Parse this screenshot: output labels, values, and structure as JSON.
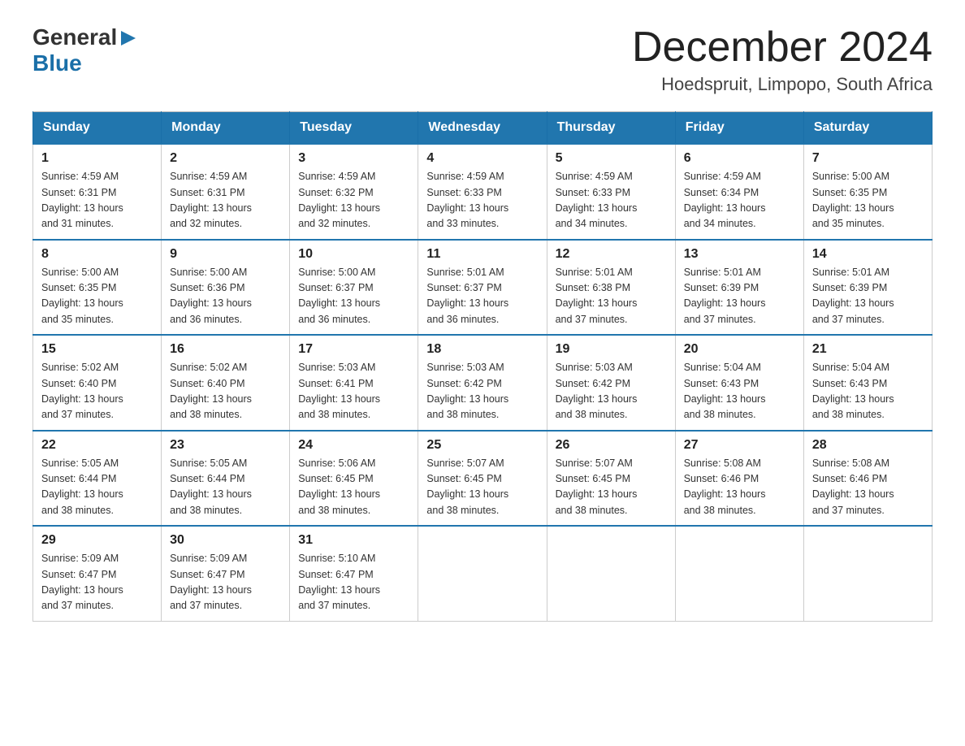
{
  "logo": {
    "general": "General",
    "arrow": "▶",
    "blue": "Blue"
  },
  "title": "December 2024",
  "subtitle": "Hoedspruit, Limpopo, South Africa",
  "weekdays": [
    "Sunday",
    "Monday",
    "Tuesday",
    "Wednesday",
    "Thursday",
    "Friday",
    "Saturday"
  ],
  "weeks": [
    [
      {
        "day": "1",
        "sunrise": "4:59 AM",
        "sunset": "6:31 PM",
        "daylight": "13 hours and 31 minutes."
      },
      {
        "day": "2",
        "sunrise": "4:59 AM",
        "sunset": "6:31 PM",
        "daylight": "13 hours and 32 minutes."
      },
      {
        "day": "3",
        "sunrise": "4:59 AM",
        "sunset": "6:32 PM",
        "daylight": "13 hours and 32 minutes."
      },
      {
        "day": "4",
        "sunrise": "4:59 AM",
        "sunset": "6:33 PM",
        "daylight": "13 hours and 33 minutes."
      },
      {
        "day": "5",
        "sunrise": "4:59 AM",
        "sunset": "6:33 PM",
        "daylight": "13 hours and 34 minutes."
      },
      {
        "day": "6",
        "sunrise": "4:59 AM",
        "sunset": "6:34 PM",
        "daylight": "13 hours and 34 minutes."
      },
      {
        "day": "7",
        "sunrise": "5:00 AM",
        "sunset": "6:35 PM",
        "daylight": "13 hours and 35 minutes."
      }
    ],
    [
      {
        "day": "8",
        "sunrise": "5:00 AM",
        "sunset": "6:35 PM",
        "daylight": "13 hours and 35 minutes."
      },
      {
        "day": "9",
        "sunrise": "5:00 AM",
        "sunset": "6:36 PM",
        "daylight": "13 hours and 36 minutes."
      },
      {
        "day": "10",
        "sunrise": "5:00 AM",
        "sunset": "6:37 PM",
        "daylight": "13 hours and 36 minutes."
      },
      {
        "day": "11",
        "sunrise": "5:01 AM",
        "sunset": "6:37 PM",
        "daylight": "13 hours and 36 minutes."
      },
      {
        "day": "12",
        "sunrise": "5:01 AM",
        "sunset": "6:38 PM",
        "daylight": "13 hours and 37 minutes."
      },
      {
        "day": "13",
        "sunrise": "5:01 AM",
        "sunset": "6:39 PM",
        "daylight": "13 hours and 37 minutes."
      },
      {
        "day": "14",
        "sunrise": "5:01 AM",
        "sunset": "6:39 PM",
        "daylight": "13 hours and 37 minutes."
      }
    ],
    [
      {
        "day": "15",
        "sunrise": "5:02 AM",
        "sunset": "6:40 PM",
        "daylight": "13 hours and 37 minutes."
      },
      {
        "day": "16",
        "sunrise": "5:02 AM",
        "sunset": "6:40 PM",
        "daylight": "13 hours and 38 minutes."
      },
      {
        "day": "17",
        "sunrise": "5:03 AM",
        "sunset": "6:41 PM",
        "daylight": "13 hours and 38 minutes."
      },
      {
        "day": "18",
        "sunrise": "5:03 AM",
        "sunset": "6:42 PM",
        "daylight": "13 hours and 38 minutes."
      },
      {
        "day": "19",
        "sunrise": "5:03 AM",
        "sunset": "6:42 PM",
        "daylight": "13 hours and 38 minutes."
      },
      {
        "day": "20",
        "sunrise": "5:04 AM",
        "sunset": "6:43 PM",
        "daylight": "13 hours and 38 minutes."
      },
      {
        "day": "21",
        "sunrise": "5:04 AM",
        "sunset": "6:43 PM",
        "daylight": "13 hours and 38 minutes."
      }
    ],
    [
      {
        "day": "22",
        "sunrise": "5:05 AM",
        "sunset": "6:44 PM",
        "daylight": "13 hours and 38 minutes."
      },
      {
        "day": "23",
        "sunrise": "5:05 AM",
        "sunset": "6:44 PM",
        "daylight": "13 hours and 38 minutes."
      },
      {
        "day": "24",
        "sunrise": "5:06 AM",
        "sunset": "6:45 PM",
        "daylight": "13 hours and 38 minutes."
      },
      {
        "day": "25",
        "sunrise": "5:07 AM",
        "sunset": "6:45 PM",
        "daylight": "13 hours and 38 minutes."
      },
      {
        "day": "26",
        "sunrise": "5:07 AM",
        "sunset": "6:45 PM",
        "daylight": "13 hours and 38 minutes."
      },
      {
        "day": "27",
        "sunrise": "5:08 AM",
        "sunset": "6:46 PM",
        "daylight": "13 hours and 38 minutes."
      },
      {
        "day": "28",
        "sunrise": "5:08 AM",
        "sunset": "6:46 PM",
        "daylight": "13 hours and 37 minutes."
      }
    ],
    [
      {
        "day": "29",
        "sunrise": "5:09 AM",
        "sunset": "6:47 PM",
        "daylight": "13 hours and 37 minutes."
      },
      {
        "day": "30",
        "sunrise": "5:09 AM",
        "sunset": "6:47 PM",
        "daylight": "13 hours and 37 minutes."
      },
      {
        "day": "31",
        "sunrise": "5:10 AM",
        "sunset": "6:47 PM",
        "daylight": "13 hours and 37 minutes."
      },
      null,
      null,
      null,
      null
    ]
  ],
  "labels": {
    "sunrise": "Sunrise:",
    "sunset": "Sunset:",
    "daylight": "Daylight:"
  }
}
